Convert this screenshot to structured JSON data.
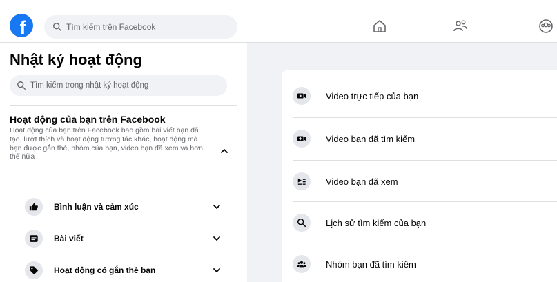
{
  "header": {
    "logo": "facebook-logo",
    "search_placeholder": "Tìm kiếm trên Facebook",
    "nav_icons": [
      "home-icon",
      "friends-icon",
      "groups-icon"
    ]
  },
  "sidebar": {
    "title": "Nhật ký hoạt động",
    "search_placeholder": "Tìm kiếm trong nhật ký hoạt động",
    "section": {
      "title": "Hoạt động của bạn trên Facebook",
      "description": "Hoạt động của bạn trên Facebook bao gồm bài viết bạn đã tạo, lượt thích và hoạt động tương tác khác, hoạt động mà bạn được gắn thẻ, nhóm của bạn, video bạn đã xem và hơn thế nữa"
    },
    "items": [
      {
        "label": "Bình luận và cảm xúc",
        "icon": "thumbs-up-icon"
      },
      {
        "label": "Bài viết",
        "icon": "post-icon"
      },
      {
        "label": "Hoạt động có gắn thẻ bạn",
        "icon": "tag-icon"
      }
    ]
  },
  "panel": {
    "items": [
      {
        "label": "Video trực tiếp của bạn",
        "icon": "live-video-icon"
      },
      {
        "label": "Video bạn đã tìm kiếm",
        "icon": "video-search-icon"
      },
      {
        "label": "Video bạn đã xem",
        "icon": "video-watched-icon"
      },
      {
        "label": "Lịch sử tìm kiếm của bạn",
        "icon": "search-icon"
      },
      {
        "label": "Nhóm bạn đã tìm kiếm",
        "icon": "groups-icon"
      }
    ]
  }
}
